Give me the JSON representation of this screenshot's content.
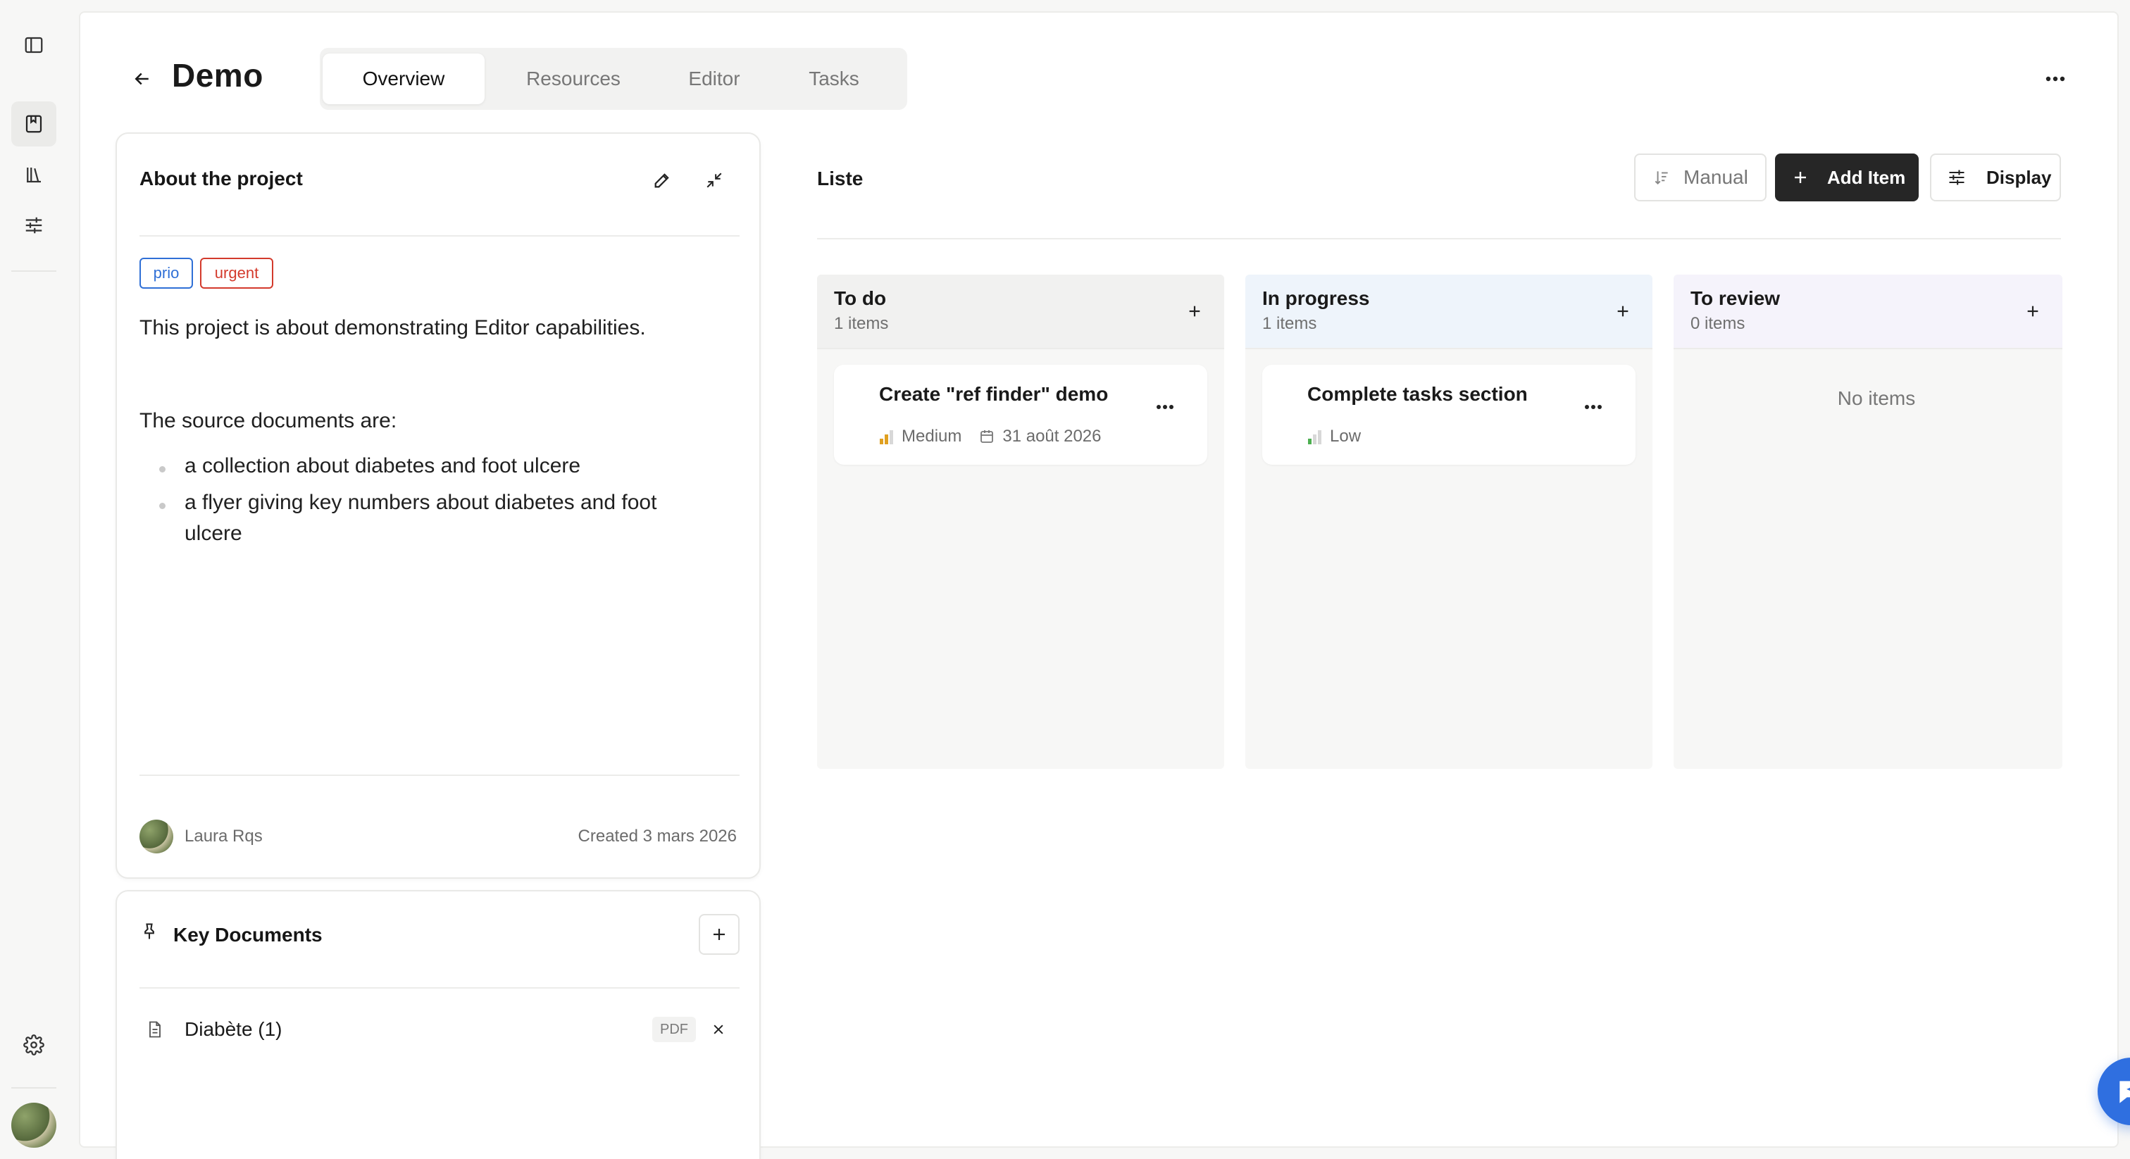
{
  "project": {
    "title": "Demo"
  },
  "tabs": [
    {
      "label": "Overview",
      "active": true
    },
    {
      "label": "Resources",
      "active": false
    },
    {
      "label": "Editor",
      "active": false
    },
    {
      "label": "Tasks",
      "active": false
    }
  ],
  "about": {
    "title": "About the project",
    "tags": [
      {
        "label": "prio",
        "color": "#2f6fd6"
      },
      {
        "label": "urgent",
        "color": "#d33a2c"
      }
    ],
    "description": "This project is about demonstrating Editor capabilities.",
    "sources_intro": "The source documents are:",
    "sources": [
      "a collection about diabetes and foot ulcere",
      "a flyer giving key numbers about diabetes and foot ulcere"
    ],
    "author": "Laura Rqs",
    "created": "Created 3 mars 2026"
  },
  "key_documents": {
    "title": "Key Documents",
    "items": [
      {
        "name": "Diabète (1)",
        "type": "PDF"
      }
    ]
  },
  "list": {
    "title": "Liste",
    "sort_label": "Manual",
    "add_label": "Add Item",
    "display_label": "Display",
    "columns": [
      {
        "title": "To do",
        "count": "1 items",
        "bg": "#f4f4f3",
        "head_bg": "#f1f1f0",
        "tasks": [
          {
            "title": "Create \"ref finder\" demo",
            "priority": "Medium",
            "priority_color": "#e0a020",
            "priority_level": 2,
            "due": "31 août 2026"
          }
        ]
      },
      {
        "title": "In progress",
        "count": "1 items",
        "bg": "#f4f4f3",
        "head_bg": "#eef4fb",
        "tasks": [
          {
            "title": "Complete tasks section",
            "priority": "Low",
            "priority_color": "#4caf50",
            "priority_level": 1,
            "due": ""
          }
        ]
      },
      {
        "title": "To review",
        "count": "0 items",
        "bg": "#f4f4f3",
        "head_bg": "#f4f2fb",
        "empty": "No items",
        "tasks": []
      }
    ]
  },
  "theme": {
    "accent": "#2f6fe0",
    "dark_button": "#262626"
  }
}
